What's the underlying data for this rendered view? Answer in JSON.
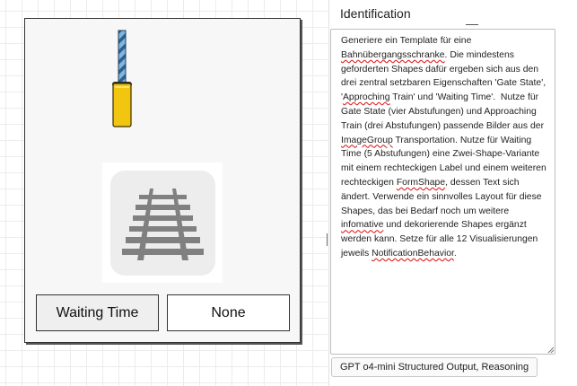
{
  "panel": {
    "title": "Identification",
    "prompt_parts": [
      "Generiere ein Template für eine ",
      "Bahnübergangsschranke",
      ". Die mindestens geforderten Shapes dafür ergeben sich aus den drei zentral setzbaren Eigenschaften 'Gate State', '",
      "Approching",
      " Train' und 'Waiting Time'.  Nutze für Gate State (vier Abstufungen) und Approaching Train (drei Abstufungen) passende Bilder aus der ",
      "ImageGroup",
      " Transportation. Nutze für Waiting Time (5 Abstufungen) eine Zwei-Shape-Variante mit einem rechteckigen Label und einem weiteren rechteckigen ",
      "FormShape",
      ", dessen Text sich ändert. Verwende ein sinnvolles Layout für diese Shapes, das bei Bedarf noch um weitere ",
      "infomative",
      " und dekorierende Shapes ergänzt werden kann. Setze für alle 12 Visualisierungen jeweils ",
      "NotificationBehavior",
      "."
    ],
    "model_button": "GPT o4-mini Structured Output, Reasoning"
  },
  "template": {
    "waiting_label": "Waiting Time",
    "waiting_value": "None"
  },
  "icons": {
    "gate": "railroad-gate-icon",
    "track": "railroad-track-icon"
  },
  "colors": {
    "gate_pole": "#7fb6e0",
    "gate_stripe": "#2f5f8f",
    "gate_box": "#f2c511",
    "track_bg": "#ededed",
    "track_fg": "#808080"
  }
}
